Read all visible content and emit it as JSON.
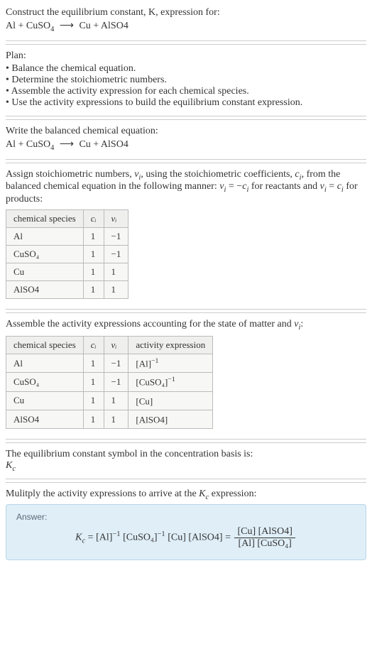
{
  "header": {
    "prompt": "Construct the equilibrium constant, K, expression for:",
    "equation_lhs": "Al + CuSO",
    "equation_sub1": "4",
    "equation_arrow": "⟶",
    "equation_rhs": "Cu + AlSO4"
  },
  "plan": {
    "title": "Plan:",
    "items": [
      "• Balance the chemical equation.",
      "• Determine the stoichiometric numbers.",
      "• Assemble the activity expression for each chemical species.",
      "• Use the activity expressions to build the equilibrium constant expression."
    ]
  },
  "balanced": {
    "title": "Write the balanced chemical equation:",
    "eq_lhs": "Al + CuSO",
    "eq_sub1": "4",
    "eq_arrow": "⟶",
    "eq_rhs": "Cu + AlSO4"
  },
  "stoich": {
    "intro_a": "Assign stoichiometric numbers, ",
    "nu": "ν",
    "sub_i": "i",
    "intro_b": ", using the stoichiometric coefficients, ",
    "c": "c",
    "intro_c": ", from the balanced chemical equation in the following manner: ",
    "rel1": " = −",
    "rel2": " for reactants and ",
    "rel3": " = ",
    "rel4": " for products:",
    "headers": {
      "h1": "chemical species",
      "h2": "cᵢ",
      "h3": "νᵢ"
    },
    "rows": [
      {
        "sp": "Al",
        "c": "1",
        "v": "−1"
      },
      {
        "sp": "CuSO₄",
        "c": "1",
        "v": "−1"
      },
      {
        "sp": "Cu",
        "c": "1",
        "v": "1"
      },
      {
        "sp": "AlSO4",
        "c": "1",
        "v": "1"
      }
    ]
  },
  "activity": {
    "title_a": "Assemble the activity expressions accounting for the state of matter and ",
    "title_b": ":",
    "headers": {
      "h1": "chemical species",
      "h2": "cᵢ",
      "h3": "νᵢ",
      "h4": "activity expression"
    },
    "rows": [
      {
        "sp": "Al",
        "c": "1",
        "v": "−1",
        "a_base": "[Al]",
        "a_exp": "−1"
      },
      {
        "sp": "CuSO₄",
        "c": "1",
        "v": "−1",
        "a_base": "[CuSO₄]",
        "a_exp": "−1"
      },
      {
        "sp": "Cu",
        "c": "1",
        "v": "1",
        "a_base": "[Cu]",
        "a_exp": ""
      },
      {
        "sp": "AlSO4",
        "c": "1",
        "v": "1",
        "a_base": "[AlSO4]",
        "a_exp": ""
      }
    ]
  },
  "symbol": {
    "line": "The equilibrium constant symbol in the concentration basis is:",
    "kc": "K",
    "kc_sub": "c"
  },
  "multiply": {
    "line_a": "Mulitply the activity expressions to arrive at the ",
    "kc": "K",
    "kc_sub": "c",
    "line_b": " expression:"
  },
  "answer": {
    "label": "Answer:",
    "kc": "K",
    "kc_sub": "c",
    "eq": " = ",
    "t1": "[Al]",
    "e1": "−1",
    "t2": " [CuSO₄]",
    "e2": "−1",
    "t3": " [Cu] [AlSO4] = ",
    "num": "[Cu] [AlSO4]",
    "den": "[Al] [CuSO₄]"
  }
}
